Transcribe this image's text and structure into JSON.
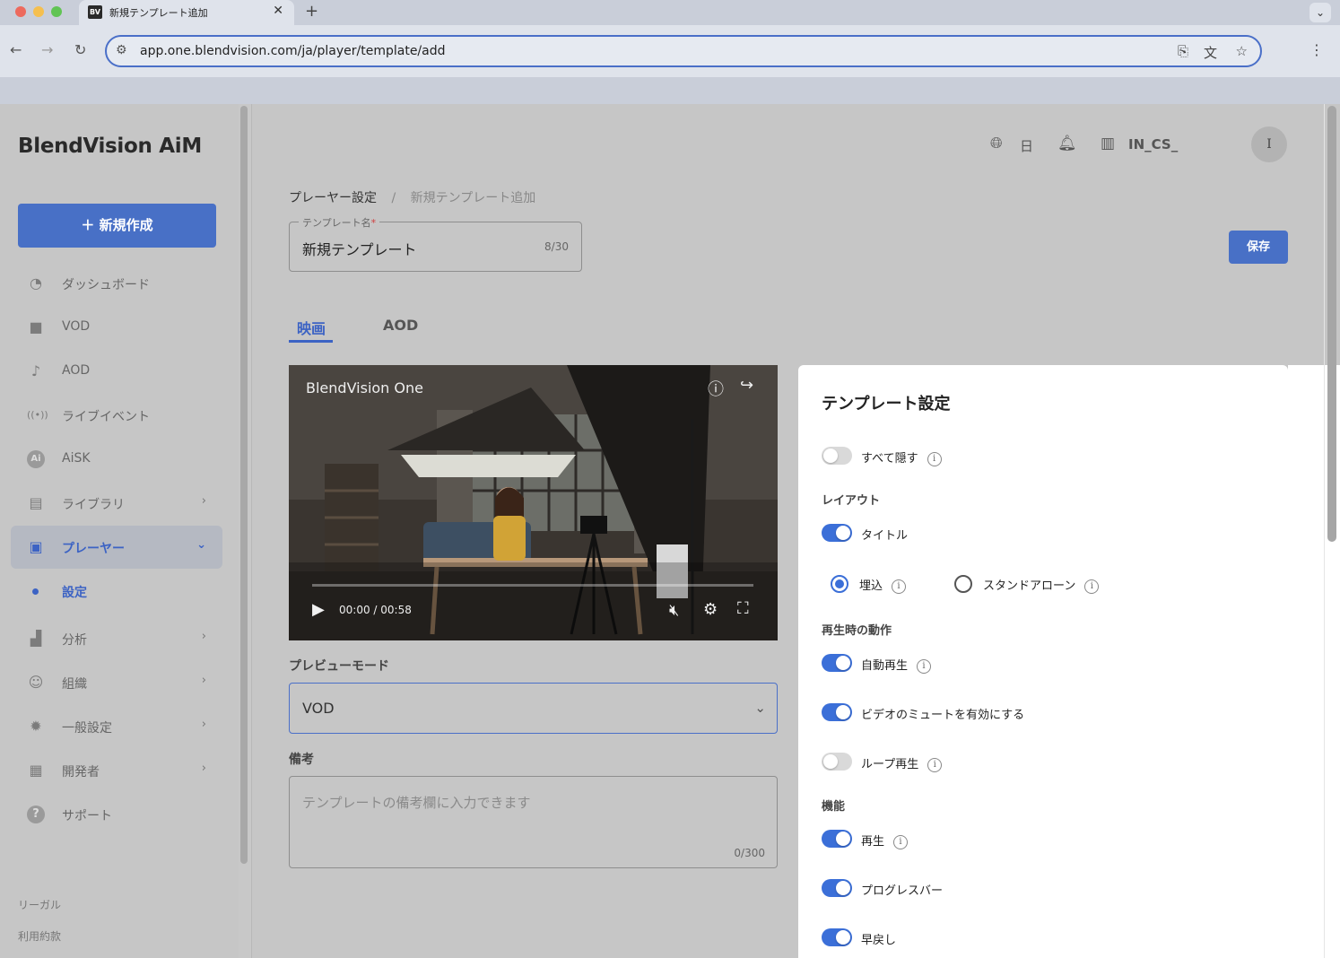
{
  "browser": {
    "tab_favicon": "BV",
    "tab_title": "新規テンプレート追加",
    "tab_close": "✕",
    "new_tab": "+",
    "url": "app.one.blendvision.com/ja/player/template/add"
  },
  "sidebar": {
    "logo": "BlendVision AiM",
    "create_button": "＋ 新規作成",
    "items": [
      {
        "label": "ダッシュボード",
        "icon": "gauge-icon"
      },
      {
        "label": "VOD",
        "icon": "video-icon"
      },
      {
        "label": "AOD",
        "icon": "music-note-icon"
      },
      {
        "label": "ライブイベント",
        "icon": "live-broadcast-icon"
      },
      {
        "label": "AiSK",
        "icon": "ai-icon"
      },
      {
        "label": "ライブラリ",
        "icon": "library-icon"
      },
      {
        "label": "プレーヤー",
        "icon": "player-icon"
      },
      {
        "label": "分析",
        "icon": "analytics-icon"
      },
      {
        "label": "組織",
        "icon": "people-icon"
      },
      {
        "label": "一般設定",
        "icon": "gear-icon"
      },
      {
        "label": "開発者",
        "icon": "developer-icon"
      },
      {
        "label": "サポート",
        "icon": "help-icon"
      }
    ],
    "sub_item": "設定",
    "footer": [
      "リーガル",
      "利用約款"
    ]
  },
  "header": {
    "language": "日",
    "org": "IN_CS_",
    "avatar_initial": "I"
  },
  "breadcrumb": {
    "parent": "プレーヤー設定",
    "separator": "/",
    "current": "新規テンプレート追加"
  },
  "template_name": {
    "label": "テンプレート名",
    "required_mark": "*",
    "value": "新規テンプレート",
    "counter": "8/30"
  },
  "save_button": "保存",
  "tabs": [
    {
      "label": "映画",
      "active": true
    },
    {
      "label": "AOD",
      "active": false
    }
  ],
  "player": {
    "title": "BlendVision One",
    "time": "00:00 / 00:58"
  },
  "preview_mode": {
    "label": "プレビューモード",
    "value": "VOD"
  },
  "memo": {
    "label": "備考",
    "placeholder": "テンプレートの備考欄に入力できます",
    "counter": "0/300"
  },
  "settings": {
    "title": "テンプレート設定",
    "hide_all": {
      "label": "すべて隠す",
      "on": false
    },
    "layout_section": "レイアウト",
    "title_toggle": {
      "label": "タイトル",
      "on": true
    },
    "radio_embed": "埋込",
    "radio_standalone": "スタンドアローン",
    "playback_section": "再生時の動作",
    "autoplay": {
      "label": "自動再生",
      "on": true
    },
    "mute": {
      "label": "ビデオのミュートを有効にする",
      "on": true
    },
    "loop": {
      "label": "ループ再生",
      "on": false
    },
    "features_section": "機能",
    "play": {
      "label": "再生",
      "on": true
    },
    "progress_bar": {
      "label": "プログレスバー",
      "on": true
    },
    "rewind": {
      "label": "早戻し",
      "on": true
    }
  },
  "colors": {
    "accent": "#3b6fd8",
    "button": "#4870c6"
  }
}
